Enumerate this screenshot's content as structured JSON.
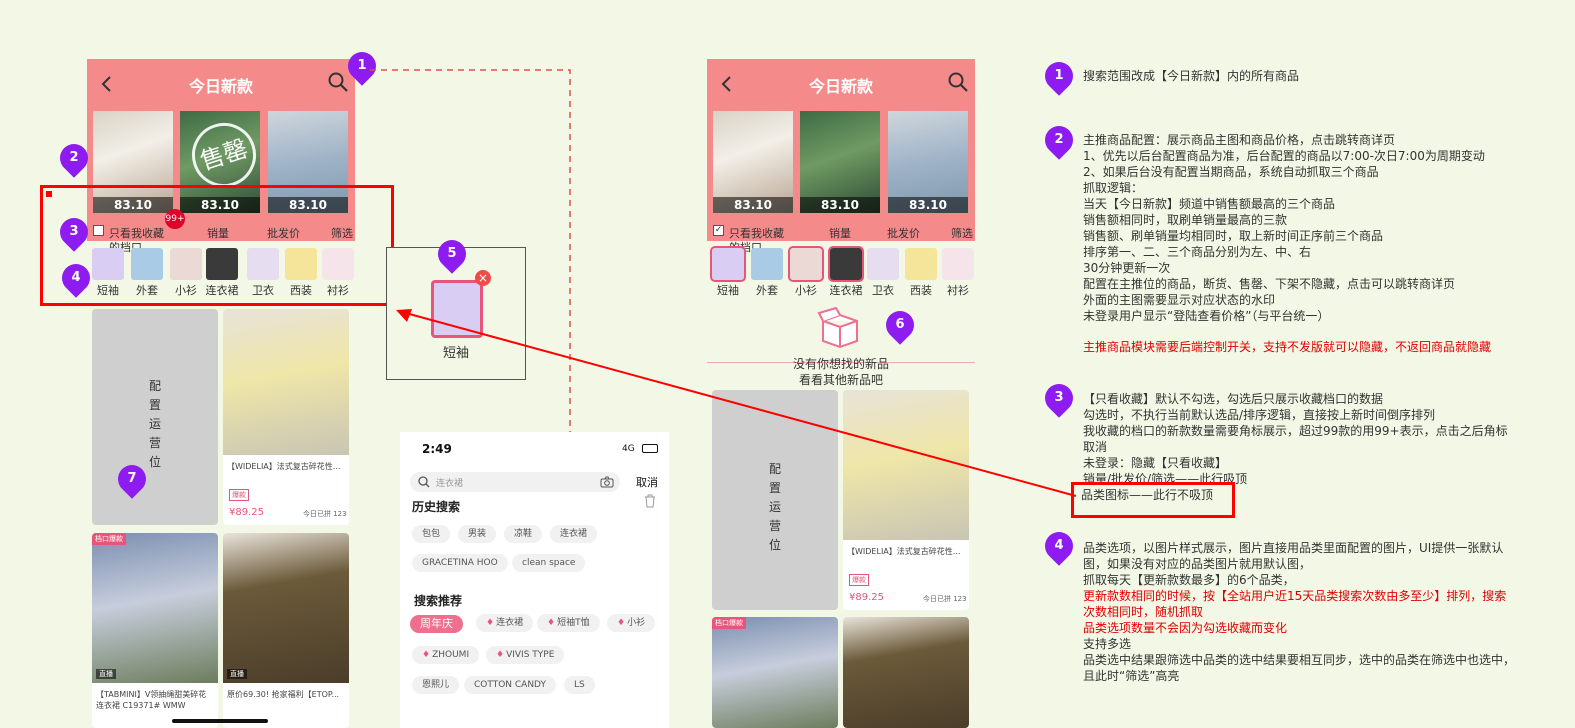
{
  "pins": [
    "1",
    "2",
    "3",
    "4",
    "5",
    "6",
    "7"
  ],
  "phone_left": {
    "title": "今日新款",
    "hero_prices": [
      "83.10",
      "83.10",
      "83.10"
    ],
    "soldout_mark": "售罄",
    "filter": {
      "only_fav": "只看我收藏",
      "only_fav_2": "的档口",
      "badge": "99+",
      "sort_sales": "销量",
      "sort_price": "批发价",
      "filter": "筛选"
    },
    "categories": [
      "短袖",
      "外套",
      "小衫",
      "连衣裙",
      "卫衣",
      "西装",
      "衬衫"
    ],
    "promo": "配置运营位",
    "product_title": "【WIDELIA】法式复古碎花性...",
    "product_tag": "爆款",
    "product_price": "¥89.25",
    "product_meta": "今日已拼 123",
    "card2_tag": "档口爆款",
    "card2_title": "【TABMINI】V领抽绳甜美碎花连衣裙 C19371# WMW",
    "card3_title": "原价69.30! 抢家福利【ETOP...",
    "live_label": "直播"
  },
  "popup_tag": {
    "label": "短袖"
  },
  "search_panel": {
    "time": "2:49",
    "signal": "4G",
    "placeholder": "连衣裙",
    "cancel": "取消",
    "history_title": "历史搜索",
    "history_row1": [
      "包包",
      "男装",
      "凉鞋",
      "连衣裙"
    ],
    "history_row2": [
      "GRACETINA HOO",
      "clean space"
    ],
    "recommend_title": "搜索推荐",
    "recommend_row1": [
      "周年庆",
      "连衣裙",
      "短袖T恤",
      "小衫"
    ],
    "recommend_row2": [
      "ZHOUMI",
      "VIVIS TYPE"
    ],
    "recommend_row3": [
      "恩熙儿",
      "COTTON CANDY",
      "LS"
    ]
  },
  "phone_right": {
    "title": "今日新款",
    "hero_prices": [
      "83.10",
      "83.10",
      "83.10"
    ],
    "filter": {
      "only_fav": "只看我收藏",
      "only_fav_2": "的档口",
      "sort_sales": "销量",
      "sort_price": "批发价",
      "filter": "筛选"
    },
    "categories": [
      "短袖",
      "外套",
      "小衫",
      "连衣裙",
      "卫衣",
      "西装",
      "衬衫"
    ],
    "empty_line1": "没有你想找的新品",
    "empty_line2": "看看其他新品吧",
    "promo": "配置运营位",
    "product_title": "【WIDELIA】法式复古碎花性...",
    "product_tag": "爆款",
    "product_price": "¥89.25",
    "product_meta": "今日已拼 123",
    "card2_tag": "档口爆款"
  },
  "notes": {
    "n1": "搜索范围改成【今日新款】内的所有商品",
    "n2": "主推商品配置：展示商品主图和商品价格，点击跳转商详页\n1、优先以后台配置商品为准，后台配置的商品以7:00-次日7:00为周期变动\n2、如果后台没有配置当期商品，系统自动抓取三个商品\n抓取逻辑：\n当天【今日新款】频道中销售额最高的三个商品\n销售额相同时，取刷单销量最高的三款\n销售额、刷单销量均相同时，取上新时间正序前三个商品\n排序第一、二、三个商品分别为左、中、右\n30分钟更新一次\n配置在主推位的商品，断货、售罄、下架不隐藏，点击可以跳转商详页\n外面的主图需要显示对应状态的水印\n未登录用户显示“登陆查看价格”（与平台统一）",
    "n2_red": "主推商品模块需要后端控制开关，支持不发版就可以隐藏，不返回商品就隐藏",
    "n3": "【只看收藏】默认不勾选，勾选后只展示收藏档口的数据\n勾选时，不执行当前默认选品/排序逻辑，直接按上新时间倒序排列\n我收藏的档口的新款数量需要角标展示，超过99款的用99+表示，点击之后角标\n取消\n未登录：隐藏【只看收藏】\n销量/批发价/筛选——此行吸顶",
    "n3_box": "品类图标——此行不吸顶",
    "n4a": "品类选项，以图片样式展示，图片直接用品类里面配置的图片，UI提供一张默认\n图，如果没有对应的品类图片就用默认图，\n抓取每天【更新款数最多】的6个品类，",
    "n4_red": "更新款数相同的时候，按【全站用户近15天品类搜索次数由多至少】排列，搜索\n次数相同时，随机抓取\n品类选项数量不会因为勾选收藏而变化",
    "n4b": "支持多选\n品类选中结果跟筛选中品类的选中结果要相互同步，选中的品类在筛选中也选中，\n且此时“筛选”高亮"
  },
  "colors": {
    "header": "#f48a8a",
    "pin": "#8e1cf0",
    "annot_red": "#ff0000",
    "accent_pink": "#e8557a"
  }
}
